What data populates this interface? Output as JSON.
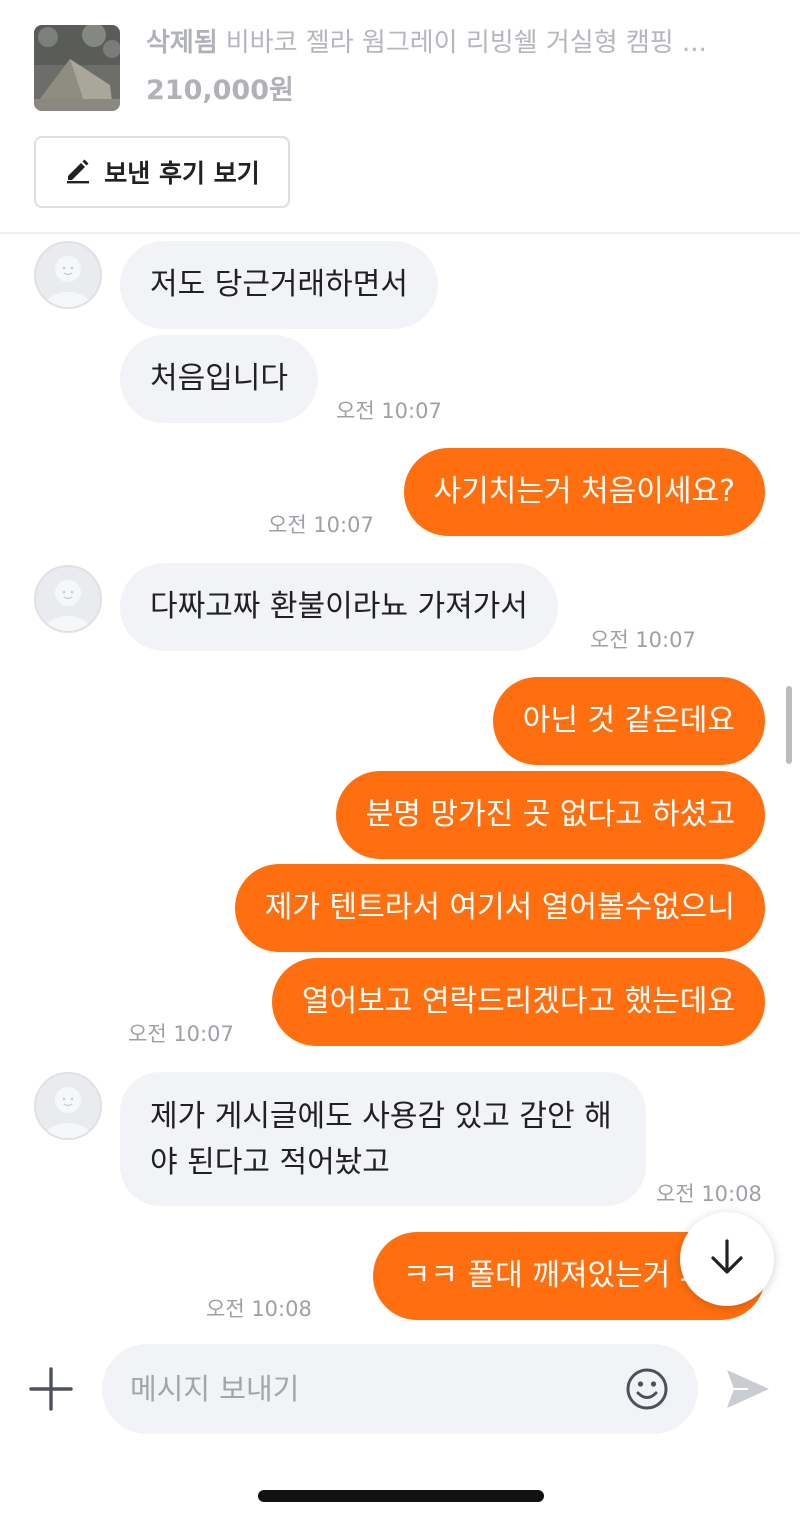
{
  "product": {
    "status": "삭제됨",
    "title": "비바코 젤라 웜그레이 리빙쉘 거실형 캠핑 ...",
    "price": "210,000원",
    "review_button": "보낸 후기 보기",
    "review_icon": "pencil-icon",
    "thumbnail_icon": "tent-photo"
  },
  "messages": [
    {
      "side": "in",
      "text": "저도 당근거래하면서"
    },
    {
      "side": "in",
      "text": "처음입니다",
      "time": "오전 10:07"
    },
    {
      "side": "out",
      "text": "사기치는거 처음이세요?",
      "time": "오전 10:07"
    },
    {
      "side": "in",
      "text": "다짜고짜 환불이라뇨 가져가서",
      "time": "오전 10:07"
    },
    {
      "side": "out",
      "text": "아닌 것 같은데요"
    },
    {
      "side": "out",
      "text": "분명 망가진 곳 없다고 하셨고"
    },
    {
      "side": "out",
      "text": "제가 텐트라서 여기서 열어볼수없으니"
    },
    {
      "side": "out",
      "text": "열어보고 연락드리겠다고 했는데요",
      "time": "오전 10:07"
    },
    {
      "side": "in",
      "text": "제가 게시글에도 사용감 있고 감안 해야 된다고 적어놨고",
      "time": "오전 10:08"
    },
    {
      "side": "out",
      "text": "ㅋㅋ 폴대 깨져있는거 파손",
      "time": "오전 10:08"
    }
  ],
  "composer": {
    "placeholder": "메시지 보내기",
    "plus_icon": "plus-icon",
    "emoji_icon": "smiley-icon",
    "send_icon": "send-icon"
  },
  "scroll_down_icon": "arrow-down-icon",
  "colors": {
    "accent": "#ff6f0f",
    "incoming_bubble": "#f2f3f6",
    "muted_text": "#9ea0a6"
  }
}
